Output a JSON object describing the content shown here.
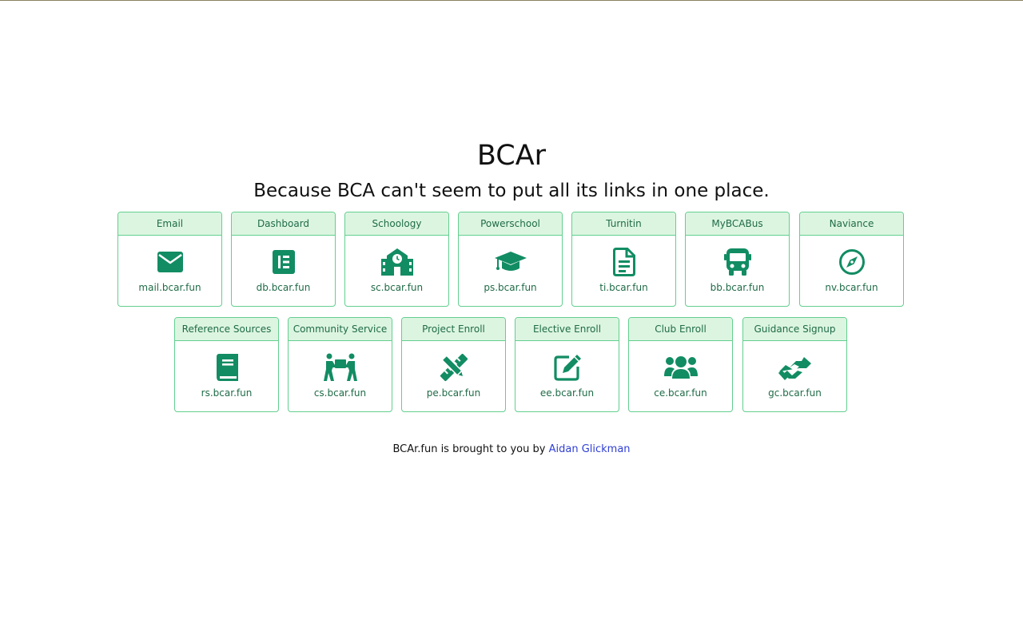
{
  "header": {
    "title": "BCAr",
    "subtitle": "Because BCA can't seem to put all its links in one place."
  },
  "colors": {
    "accent": "#128c63",
    "card_border": "#63cf8f",
    "card_header_bg": "#dcf5e1",
    "link": "#2f3fd4"
  },
  "cards": [
    {
      "title": "Email",
      "url": "mail.bcar.fun",
      "icon": "envelope-icon"
    },
    {
      "title": "Dashboard",
      "url": "db.bcar.fun",
      "icon": "dashboard-icon"
    },
    {
      "title": "Schoology",
      "url": "sc.bcar.fun",
      "icon": "school-icon"
    },
    {
      "title": "Powerschool",
      "url": "ps.bcar.fun",
      "icon": "graduation-cap-icon"
    },
    {
      "title": "Turnitin",
      "url": "ti.bcar.fun",
      "icon": "document-icon"
    },
    {
      "title": "MyBCABus",
      "url": "bb.bcar.fun",
      "icon": "bus-icon"
    },
    {
      "title": "Naviance",
      "url": "nv.bcar.fun",
      "icon": "compass-icon"
    },
    {
      "title": "Reference Sources",
      "url": "rs.bcar.fun",
      "icon": "book-icon"
    },
    {
      "title": "Community Service",
      "url": "cs.bcar.fun",
      "icon": "people-carry-icon"
    },
    {
      "title": "Project Enroll",
      "url": "pe.bcar.fun",
      "icon": "pencil-ruler-icon"
    },
    {
      "title": "Elective Enroll",
      "url": "ee.bcar.fun",
      "icon": "edit-icon"
    },
    {
      "title": "Club Enroll",
      "url": "ce.bcar.fun",
      "icon": "users-icon"
    },
    {
      "title": "Guidance Signup",
      "url": "gc.bcar.fun",
      "icon": "handshake-icon"
    }
  ],
  "footer": {
    "text": "BCAr.fun is brought to you by",
    "author": "Aidan Glickman"
  }
}
